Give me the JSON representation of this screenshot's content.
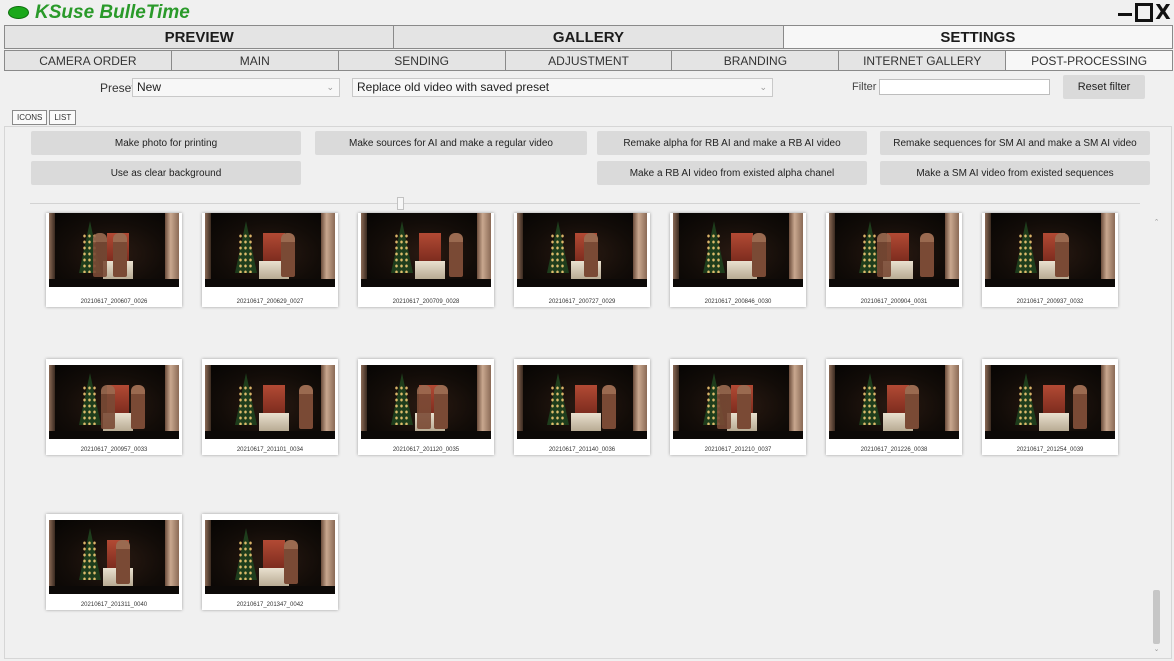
{
  "app": {
    "title": "KSuse BulleTime",
    "window_controls": {
      "minimize": "minimize-icon",
      "maximize": "maximize-icon",
      "close": "X"
    }
  },
  "main_tabs": [
    {
      "label": "PREVIEW",
      "active": false
    },
    {
      "label": "GALLERY",
      "active": false
    },
    {
      "label": "SETTINGS",
      "active": true
    }
  ],
  "sub_tabs": [
    {
      "label": "CAMERA ORDER",
      "active": false
    },
    {
      "label": "MAIN",
      "active": false
    },
    {
      "label": "SENDING",
      "active": false
    },
    {
      "label": "ADJUSTMENT",
      "active": false
    },
    {
      "label": "BRANDING",
      "active": false
    },
    {
      "label": "INTERNET GALLERY",
      "active": false
    },
    {
      "label": "POST-PROCESSING",
      "active": true
    }
  ],
  "preset": {
    "label": "Preset",
    "value": "New",
    "action_value": "Replace old video with saved preset"
  },
  "filter": {
    "label": "Filter",
    "value": "",
    "reset_label": "Reset filter"
  },
  "view_toggle": {
    "icons": "ICONS",
    "list": "LIST",
    "active": "ICONS"
  },
  "actions": [
    "Make photo for printing",
    "Make sources for AI and make a regular video",
    "Remake alpha for RB AI and make a RB AI video",
    "Remake sequences for SM AI and make a SM AI video",
    "Use as clear background",
    "Make a RB AI video from existed alpha chanel",
    "Make a SM AI video from existed sequences"
  ],
  "thumbnails": [
    "20210617_200607_0026",
    "20210617_200629_0027",
    "20210617_200709_0028",
    "20210617_200727_0029",
    "20210617_200846_0030",
    "20210617_200904_0031",
    "20210617_200937_0032",
    "20210617_200957_0033",
    "20210617_201101_0034",
    "20210617_201120_0035",
    "20210617_201140_0036",
    "20210617_201210_0037",
    "20210617_201226_0038",
    "20210617_201254_0039",
    "20210617_201311_0040",
    "20210617_201347_0042"
  ],
  "colors": {
    "brand_green": "#2a9a2a",
    "logo_green": "#1aa81a",
    "background": "#f0f0f0",
    "button": "#dadada"
  },
  "scroll": {
    "position": 0.85
  }
}
